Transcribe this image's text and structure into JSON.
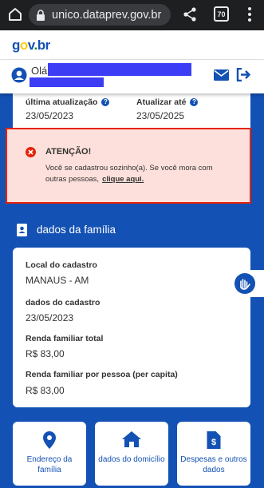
{
  "browser": {
    "url": "unico.dataprev.gov.br",
    "tab_count": "70"
  },
  "header": {
    "logo_text": "gov.br",
    "greeting": "Olá,"
  },
  "info": {
    "last_update_label": "última atualização",
    "last_update_value": "23/05/2023",
    "update_until_label": "Atualizar até",
    "update_until_value": "23/05/2025"
  },
  "alert": {
    "title": "ATENÇÃO!",
    "message": "Você se cadastrou sozinho(a). Se você mora com outras pessoas,",
    "link": "clique aqui."
  },
  "section": {
    "title": "dados da família"
  },
  "family": {
    "fields": [
      {
        "label": "Local do cadastro",
        "value": "MANAUS - AM"
      },
      {
        "label": "dados do cadastro",
        "value": "23/05/2023"
      },
      {
        "label": "Renda familiar total",
        "value": "R$ 83,00"
      },
      {
        "label": "Renda familiar por pessoa (per capita)",
        "value": "R$ 83,00"
      }
    ]
  },
  "nav": [
    {
      "label": "Endereço da família",
      "icon": "location-pin-icon"
    },
    {
      "label": "dados do domicílio",
      "icon": "home-icon"
    },
    {
      "label": "Despesas e outros dados",
      "icon": "expense-document-icon"
    }
  ],
  "colors": {
    "primary": "#1351b4",
    "alert_bg": "#fde0db",
    "alert_border": "#e52207",
    "error_icon": "#e52207"
  }
}
